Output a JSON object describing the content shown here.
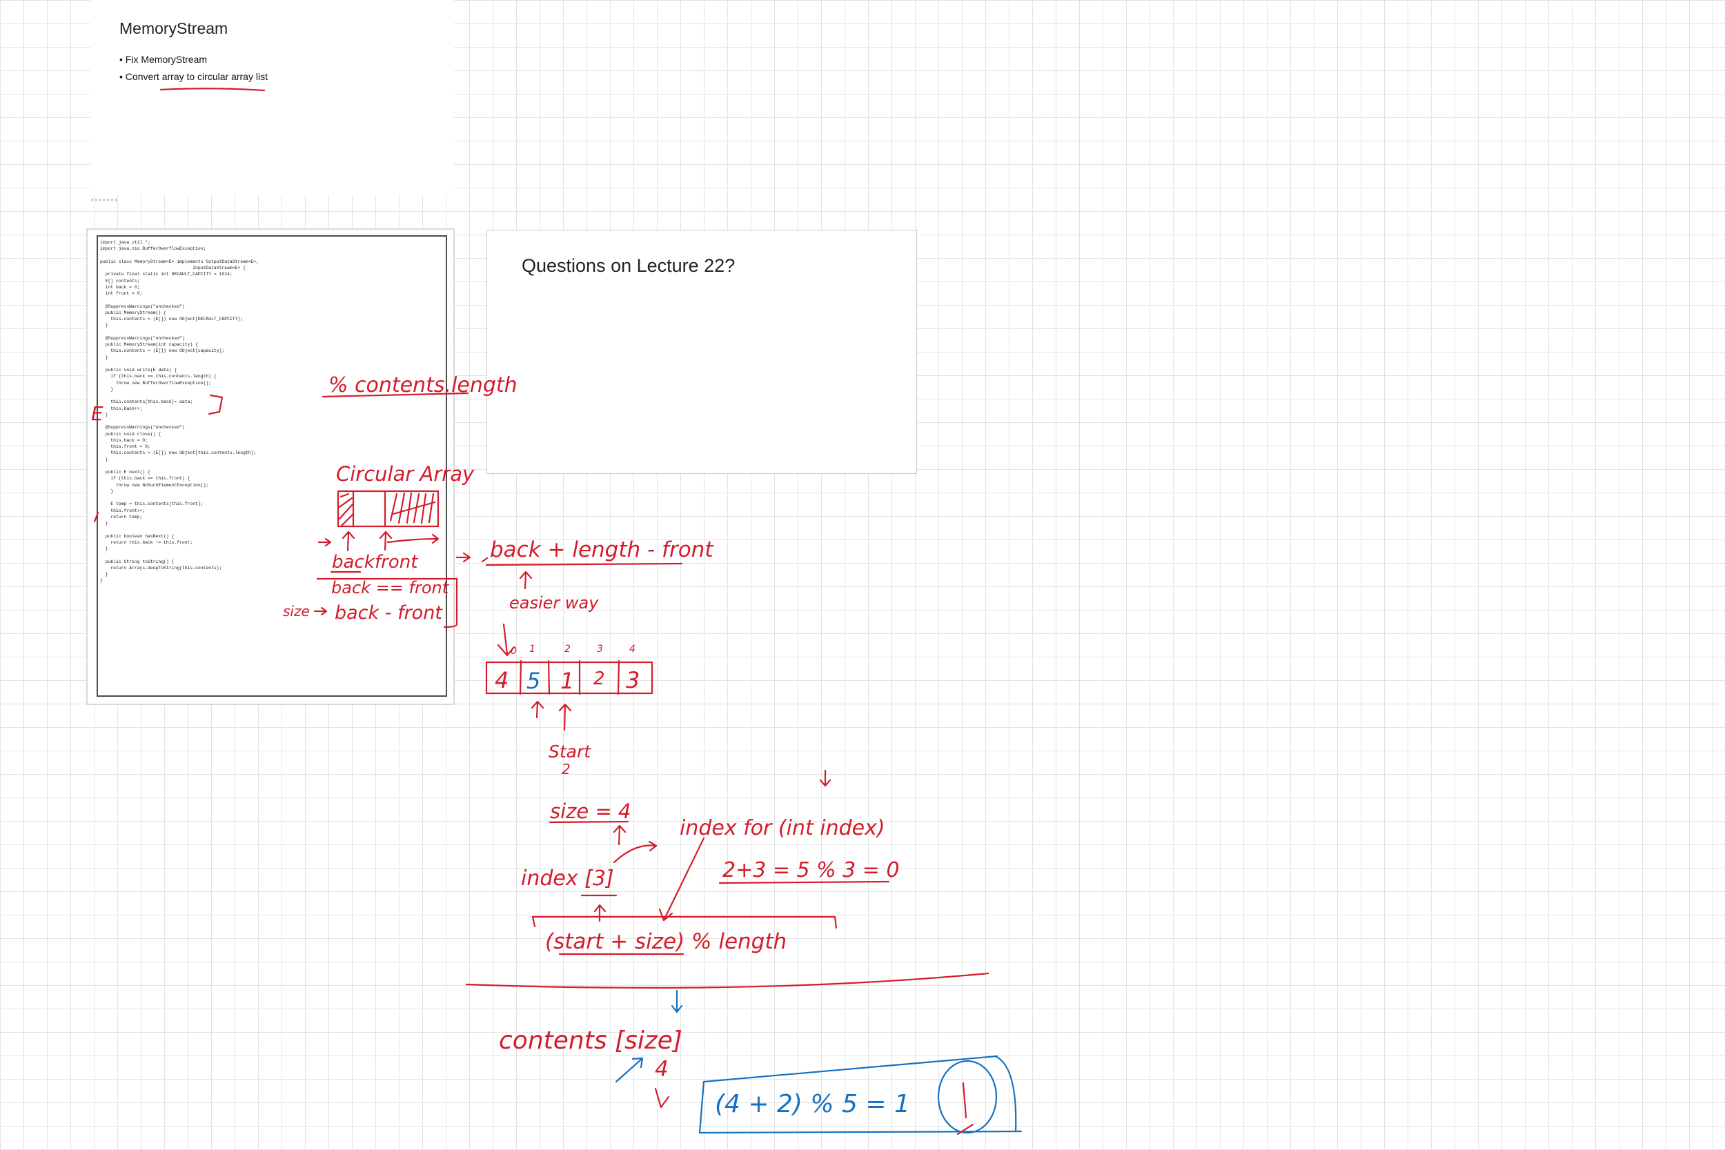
{
  "slide1": {
    "title": "MemoryStream",
    "bullets": [
      "Fix MemoryStream",
      "Convert array to circular array list"
    ]
  },
  "slide2": {
    "code": "import java.util.*;\nimport java.nio.BufferOverflowException;\n\npublic class MemoryStream<E> implements OutputDataStream<E>,\n                                   InputDataStream<E> {\n  private final static int DEFAULT_CAPCITY = 1024;\n  E[] contents;\n  int back = 0;\n  int front = 0;\n\n  @SuppressWarnings(\"unchecked\")\n  public MemoryStream() {\n    this.contents = (E[]) new Object[DEFAULT_CAPCITY];\n  }\n\n  @SuppressWarnings(\"unchecked\")\n  public MemoryStream(int capacity) {\n    this.contents = (E[]) new Object[capacity];\n  }\n\n  public void write(E data) {\n    if (this.back == this.contents.length) {\n      throw new BufferOverflowException();\n    }\n\n    this.contents[this.back]= data;\n    this.back++;\n  }\n\n  @SuppressWarnings(\"unchecked\")\n  public void close() {\n    this.back = 0;\n    this.front = 0;\n    this.contents = (E[]) new Object[this.contents.length];\n  }\n\n  public E next() {\n    if (this.back == this.front) {\n      throw new NoSuchElementException();\n    }\n\n    E temp = this.contents[this.front];\n    this.front++;\n    return temp;\n  }\n\n  public boolean hasNext() {\n    return this.back != this.front;\n  }\n\n  public String toString() {\n    return Arrays.deepToString(this.contents);\n  }\n}"
  },
  "slide3": {
    "title": "Questions on Lecture 22?"
  },
  "ink": {
    "mod_length": "% contents.length",
    "circular_array": "Circular Array",
    "back": "back",
    "front": "front",
    "back_eq_front": "back == front",
    "size_label": "size",
    "back_minus_front": "back - front",
    "formula": "back + length - front",
    "easier_way": "easier way",
    "indices": [
      "0",
      "1",
      "2",
      "3",
      "4"
    ],
    "cells": [
      "4",
      "5",
      "1",
      "2",
      "3"
    ],
    "start": "Start",
    "start_value": "2",
    "size_eq": "size = 4",
    "index_for": "index for (int index)",
    "index_bracket": "index [3]",
    "calc": "2+3 = 5 % 3 = 0",
    "expr": "(start + size) % length",
    "contents_size": "contents [size]",
    "four": "4",
    "result": "(4 + 2) % 5 = 1"
  }
}
